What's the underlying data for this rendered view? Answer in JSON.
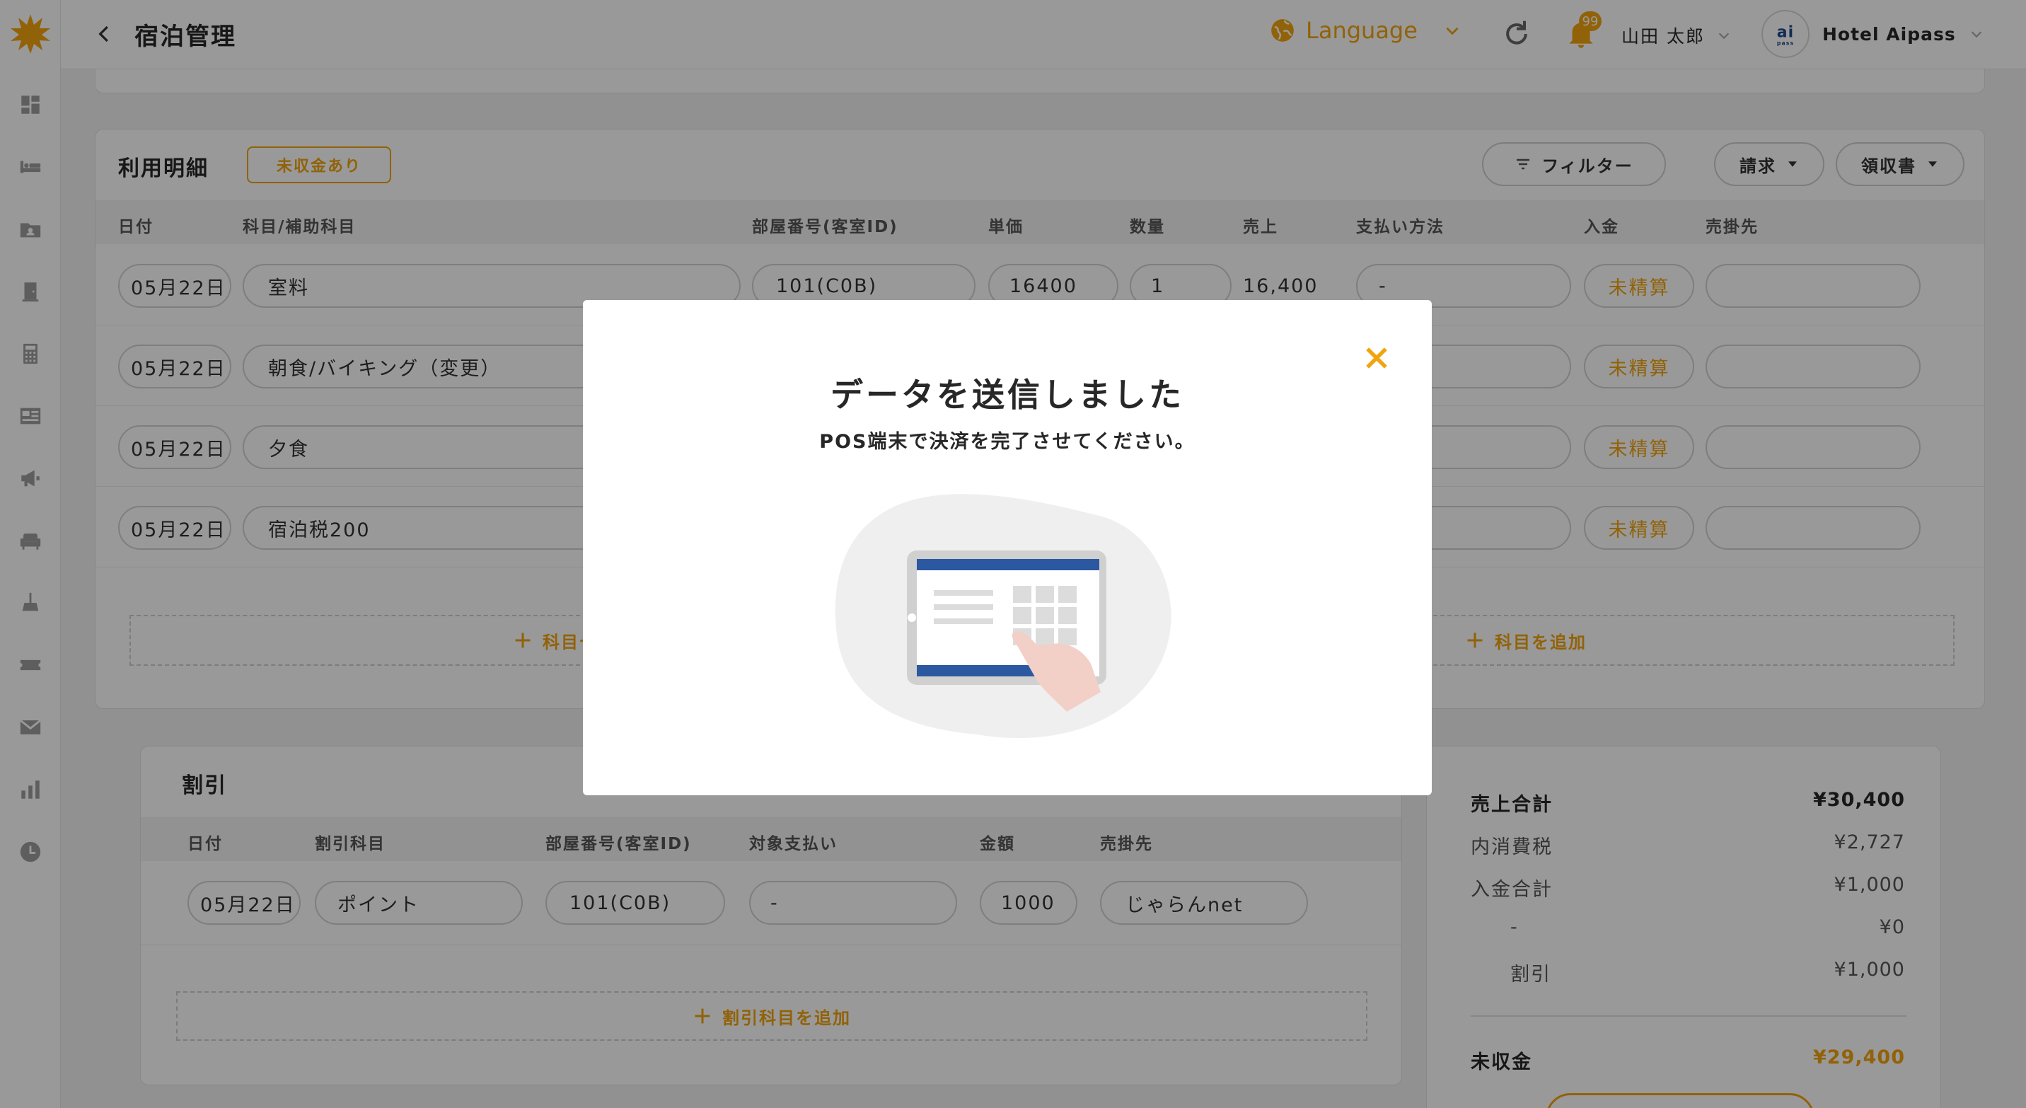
{
  "header": {
    "page_title": "宿泊管理",
    "language_label": "Language",
    "notification_count": "99",
    "user_name": "山田 太郎",
    "hotel_name": "Hotel Aipass"
  },
  "usage": {
    "title": "利用明細",
    "badge": "未収金あり",
    "filter_label": "フィルター",
    "billing_label": "請求",
    "receipt_label": "領収書",
    "columns": [
      "日付",
      "科目/補助科目",
      "部屋番号(客室ID)",
      "単価",
      "数量",
      "売上",
      "支払い方法",
      "入金",
      "売掛先"
    ],
    "rows": [
      {
        "date": "05月22日",
        "subject": "室料",
        "room": "101(C0B)",
        "unit_price": "16400",
        "qty": "1",
        "sales": "16,400",
        "payment": "-",
        "status": "未精算"
      },
      {
        "date": "05月22日",
        "subject": "朝食/バイキング（変更）",
        "status": "未精算"
      },
      {
        "date": "05月22日",
        "subject": "夕食",
        "status": "未精算"
      },
      {
        "date": "05月22日",
        "subject": "宿泊税200",
        "status": "未精算"
      }
    ],
    "add_set_label": "科目セ",
    "add_subject_label": "科目を追加"
  },
  "discount": {
    "title": "割引",
    "columns": [
      "日付",
      "割引科目",
      "部屋番号(客室ID)",
      "対象支払い",
      "金額",
      "売掛先"
    ],
    "row": {
      "date": "05月22日",
      "subject": "ポイント",
      "room": "101(C0B)",
      "target": "-",
      "amount": "1000",
      "account": "じゃらんnet"
    },
    "add_label": "割引科目を追加"
  },
  "summary": {
    "sales_total_label": "売上合計",
    "sales_total": "¥30,400",
    "tax_label": "内消費税",
    "tax": "¥2,727",
    "payment_total_label": "入金合計",
    "payment_total": "¥1,000",
    "dash_label": "-",
    "dash_value": "¥0",
    "discount_label": "割引",
    "discount_value": "¥1,000",
    "unpaid_label": "未収金",
    "unpaid": "¥29,400"
  },
  "modal": {
    "title": "データを送信しました",
    "subtitle": "POS端末で決済を完了させてください。"
  },
  "colors": {
    "accent": "#f2a40e",
    "tablet_blue": "#2b58a0"
  }
}
